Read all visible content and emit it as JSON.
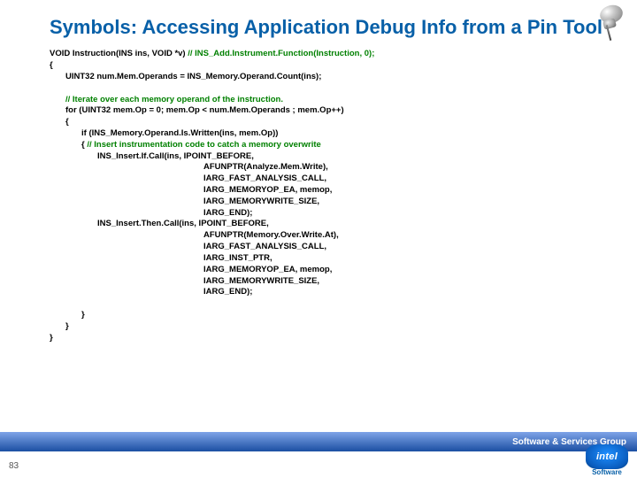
{
  "title": "Symbols: Accessing Application Debug Info from a Pin Tool",
  "code": [
    {
      "indent": 0,
      "segs": [
        {
          "c": "black",
          "t": "VOID Instruction(INS ins, VOID *v) "
        },
        {
          "c": "green",
          "t": "// INS_Add.Instrument.Function(Instruction, 0);"
        }
      ]
    },
    {
      "indent": 0,
      "segs": [
        {
          "c": "black",
          "t": "{"
        }
      ]
    },
    {
      "indent": 1,
      "segs": [
        {
          "c": "black",
          "t": "UINT32 num.Mem.Operands = INS_Memory.Operand.Count(ins);"
        }
      ]
    },
    {
      "indent": 0,
      "segs": [
        {
          "c": "black",
          "t": " "
        }
      ]
    },
    {
      "indent": 1,
      "segs": [
        {
          "c": "green",
          "t": "// Iterate over each memory operand of the instruction."
        }
      ]
    },
    {
      "indent": 1,
      "segs": [
        {
          "c": "black",
          "t": "for (UINT32 mem.Op = 0; mem.Op < num.Mem.Operands ; mem.Op++)"
        }
      ]
    },
    {
      "indent": 1,
      "segs": [
        {
          "c": "black",
          "t": "{"
        }
      ]
    },
    {
      "indent": 2,
      "segs": [
        {
          "c": "black",
          "t": "if (INS_Memory.Operand.Is.Written(ins, mem.Op))"
        }
      ]
    },
    {
      "indent": 2,
      "segs": [
        {
          "c": "black",
          "t": "{ "
        },
        {
          "c": "green",
          "t": "// Insert instrumentation code to catch a memory overwrite"
        }
      ]
    },
    {
      "indent": 3,
      "segs": [
        {
          "c": "black",
          "t": "INS_Insert.If.Call(ins, IPOINT_BEFORE,"
        }
      ]
    },
    {
      "indent": 5,
      "segs": [
        {
          "c": "black",
          "t": "AFUNPTR(Analyze.Mem.Write),"
        }
      ]
    },
    {
      "indent": 5,
      "segs": [
        {
          "c": "black",
          "t": "IARG_FAST_ANALYSIS_CALL,"
        }
      ]
    },
    {
      "indent": 5,
      "segs": [
        {
          "c": "black",
          "t": "IARG_MEMORYOP_EA, memop,"
        }
      ]
    },
    {
      "indent": 5,
      "segs": [
        {
          "c": "black",
          "t": "IARG_MEMORYWRITE_SIZE,"
        }
      ]
    },
    {
      "indent": 5,
      "segs": [
        {
          "c": "black",
          "t": "IARG_END);"
        }
      ]
    },
    {
      "indent": 3,
      "segs": [
        {
          "c": "black",
          "t": "INS_Insert.Then.Call(ins, IPOINT_BEFORE,"
        }
      ]
    },
    {
      "indent": 5,
      "segs": [
        {
          "c": "black",
          "t": "AFUNPTR(Memory.Over.Write.At),"
        }
      ]
    },
    {
      "indent": 5,
      "segs": [
        {
          "c": "black",
          "t": "IARG_FAST_ANALYSIS_CALL,"
        }
      ]
    },
    {
      "indent": 5,
      "segs": [
        {
          "c": "black",
          "t": "IARG_INST_PTR,"
        }
      ]
    },
    {
      "indent": 5,
      "segs": [
        {
          "c": "black",
          "t": "IARG_MEMORYOP_EA, memop,"
        }
      ]
    },
    {
      "indent": 5,
      "segs": [
        {
          "c": "black",
          "t": "IARG_MEMORYWRITE_SIZE,"
        }
      ]
    },
    {
      "indent": 5,
      "segs": [
        {
          "c": "black",
          "t": "IARG_END);"
        }
      ]
    },
    {
      "indent": 0,
      "segs": [
        {
          "c": "black",
          "t": " "
        }
      ]
    },
    {
      "indent": 2,
      "segs": [
        {
          "c": "black",
          "t": "}"
        }
      ]
    },
    {
      "indent": 1,
      "segs": [
        {
          "c": "black",
          "t": "}"
        }
      ]
    },
    {
      "indent": 0,
      "segs": [
        {
          "c": "black",
          "t": "}"
        }
      ]
    }
  ],
  "footer": {
    "group": "Software & Services Group",
    "software": "Software",
    "logo": "intel"
  },
  "page": "83"
}
